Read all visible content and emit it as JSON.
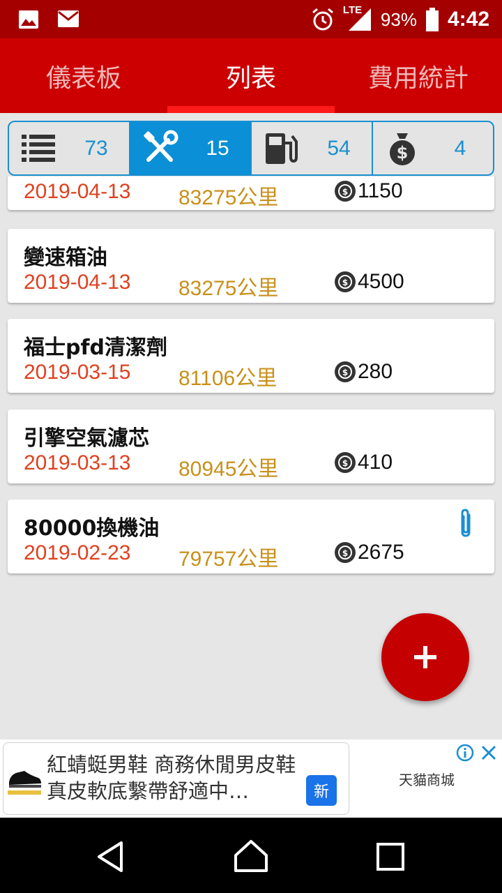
{
  "status_bar": {
    "network": "LTE",
    "battery": "93%",
    "time": "4:42"
  },
  "tabs": [
    {
      "label": "儀表板",
      "active": false
    },
    {
      "label": "列表",
      "active": true
    },
    {
      "label": "費用統計",
      "active": false
    }
  ],
  "filters": [
    {
      "icon": "list-icon",
      "count": "73",
      "active": false
    },
    {
      "icon": "tools-icon",
      "count": "15",
      "active": true
    },
    {
      "icon": "fuel-icon",
      "count": "54",
      "active": false
    },
    {
      "icon": "money-bag-icon",
      "count": "4",
      "active": false
    }
  ],
  "records": [
    {
      "title": "",
      "date": "2019-04-13",
      "km": "83275公里",
      "cost": "1150",
      "attachment": false
    },
    {
      "title": "變速箱油",
      "date": "2019-04-13",
      "km": "83275公里",
      "cost": "4500",
      "attachment": false
    },
    {
      "title": "福士pfd清潔劑",
      "date": "2019-03-15",
      "km": "81106公里",
      "cost": "280",
      "attachment": false
    },
    {
      "title": "引擎空氣濾芯",
      "date": "2019-03-13",
      "km": "80945公里",
      "cost": "410",
      "attachment": false
    },
    {
      "title": "80000換機油",
      "date": "2019-02-23",
      "km": "79757公里",
      "cost": "2675",
      "attachment": true
    }
  ],
  "ad": {
    "text": "紅蜻蜓男鞋 商務休閒男皮鞋 真皮軟底繫帶舒適中…",
    "badge": "新",
    "advertiser": "天貓商城"
  },
  "colors": {
    "primary": "#cc0000",
    "status_bar": "#a40000",
    "accent_blue": "#0b8fd6",
    "date_red": "#e0401f",
    "km_orange": "#c8901a"
  }
}
